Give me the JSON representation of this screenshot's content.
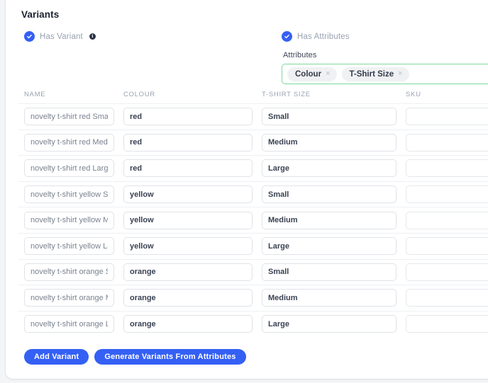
{
  "card": {
    "title": "Variants"
  },
  "has_variant": {
    "label": "Has Variant",
    "info_glyph": "i",
    "checked": true
  },
  "has_attributes": {
    "label": "Has Attributes",
    "checked": true
  },
  "attributes_field": {
    "label": "Attributes",
    "chips": [
      {
        "label": "Colour",
        "remove": "×"
      },
      {
        "label": "T-Shirt Size",
        "remove": "×"
      }
    ]
  },
  "table": {
    "headers": {
      "name": "NAME",
      "colour": "COLOUR",
      "size": "T-SHIRT SIZE",
      "sku": "SKU"
    },
    "rows": [
      {
        "name": "novelty t-shirt red Small",
        "colour": "red",
        "size": "Small",
        "sku": ""
      },
      {
        "name": "novelty t-shirt red Medium",
        "colour": "red",
        "size": "Medium",
        "sku": ""
      },
      {
        "name": "novelty t-shirt red Large",
        "colour": "red",
        "size": "Large",
        "sku": ""
      },
      {
        "name": "novelty t-shirt yellow Small",
        "colour": "yellow",
        "size": "Small",
        "sku": ""
      },
      {
        "name": "novelty t-shirt yellow Medium",
        "colour": "yellow",
        "size": "Medium",
        "sku": ""
      },
      {
        "name": "novelty t-shirt yellow Large",
        "colour": "yellow",
        "size": "Large",
        "sku": ""
      },
      {
        "name": "novelty t-shirt orange Small",
        "colour": "orange",
        "size": "Small",
        "sku": ""
      },
      {
        "name": "novelty t-shirt orange Medium",
        "colour": "orange",
        "size": "Medium",
        "sku": ""
      },
      {
        "name": "novelty t-shirt orange Large",
        "colour": "orange",
        "size": "Large",
        "sku": ""
      }
    ]
  },
  "actions": {
    "add_variant": "Add Variant",
    "generate_variants": "Generate Variants From Attributes"
  },
  "colors": {
    "accent_blue": "#3560f4",
    "focus_green": "#7fd79a",
    "chip_bg": "#f0f1f3",
    "page_bg": "#f4f5f7",
    "border": "#dfe3e8"
  }
}
